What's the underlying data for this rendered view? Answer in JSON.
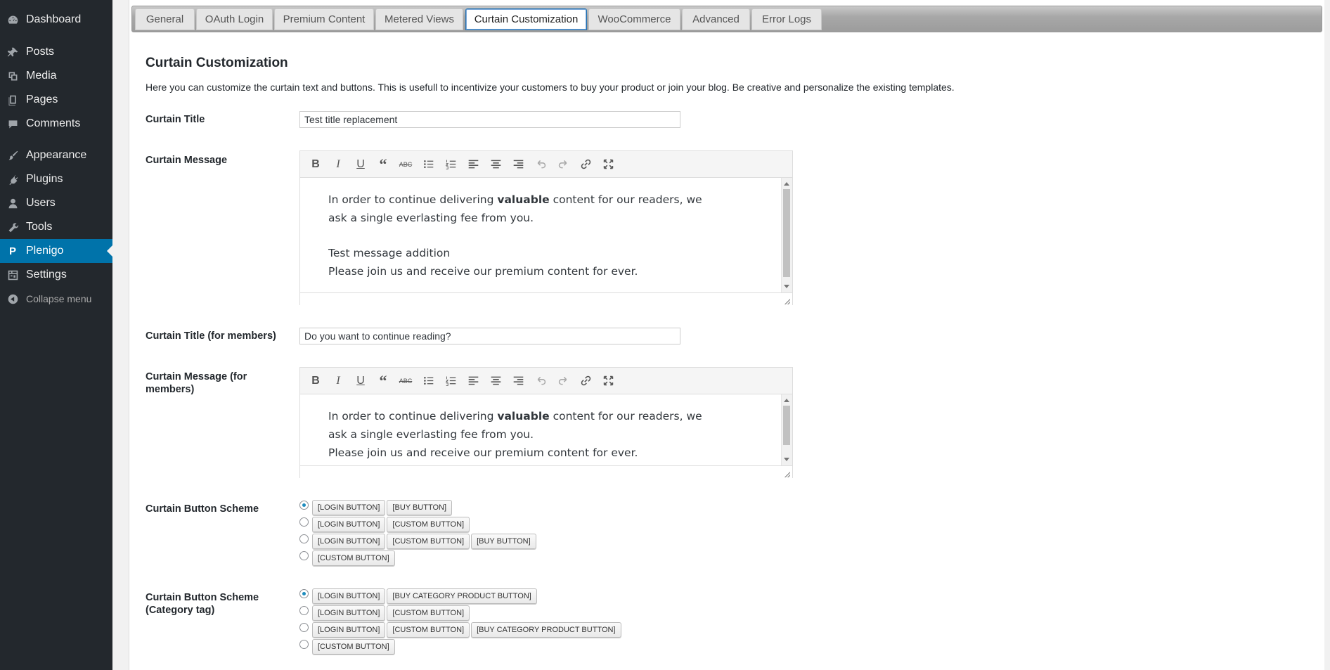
{
  "sidebar": {
    "items": [
      {
        "label": "Dashboard",
        "icon": "dashboard-icon"
      },
      {
        "label": "Posts",
        "icon": "pin-icon"
      },
      {
        "label": "Media",
        "icon": "media-icon"
      },
      {
        "label": "Pages",
        "icon": "pages-icon"
      },
      {
        "label": "Comments",
        "icon": "comments-icon"
      },
      {
        "label": "Appearance",
        "icon": "paintbrush-icon"
      },
      {
        "label": "Plugins",
        "icon": "plugin-icon"
      },
      {
        "label": "Users",
        "icon": "users-icon"
      },
      {
        "label": "Tools",
        "icon": "wrench-icon"
      },
      {
        "label": "Plenigo",
        "icon": "P"
      },
      {
        "label": "Settings",
        "icon": "settings-icon"
      },
      {
        "label": "Collapse menu",
        "icon": "collapse-icon"
      }
    ],
    "active": "Plenigo"
  },
  "tabs": [
    "General",
    "OAuth Login",
    "Premium Content",
    "Metered Views",
    "Curtain Customization",
    "WooCommerce",
    "Advanced",
    "Error Logs"
  ],
  "active_tab": "Curtain Customization",
  "section": {
    "title": "Curtain Customization",
    "intro": "Here you can customize the curtain text and buttons. This is usefull to incentivize your customers to buy your product or join your blog. Be creative and personalize the existing templates."
  },
  "fields": {
    "curtain_title": {
      "label": "Curtain Title",
      "value": "Test title replacement"
    },
    "curtain_message": {
      "label": "Curtain Message",
      "text_before": "In order to continue delivering ",
      "text_bold": "valuable",
      "text_after": " content for our readers, we ask a single everlasting fee from you.",
      "line3": "Test message addition",
      "line4": "Please join us and receive our premium content for ever."
    },
    "curtain_title_members": {
      "label": "Curtain Title (for members)",
      "value": "Do you want to continue reading?"
    },
    "curtain_message_members": {
      "label": "Curtain Message (for members)",
      "text_before": "In order to continue delivering ",
      "text_bold": "valuable",
      "text_after": " content for our readers, we ask a single everlasting fee from you.",
      "line3": "Please join us and receive our premium content for ever."
    },
    "button_scheme": {
      "label": "Curtain Button Scheme",
      "selected": 0,
      "options": [
        [
          "[LOGIN BUTTON]",
          "[BUY BUTTON]"
        ],
        [
          "[LOGIN BUTTON]",
          "[CUSTOM BUTTON]"
        ],
        [
          "[LOGIN BUTTON]",
          "[CUSTOM BUTTON]",
          "[BUY BUTTON]"
        ],
        [
          "[CUSTOM BUTTON]"
        ]
      ]
    },
    "button_scheme_category": {
      "label": "Curtain Button Scheme (Category tag)",
      "selected": 0,
      "options": [
        [
          "[LOGIN BUTTON]",
          "[BUY CATEGORY PRODUCT BUTTON]"
        ],
        [
          "[LOGIN BUTTON]",
          "[CUSTOM BUTTON]"
        ],
        [
          "[LOGIN BUTTON]",
          "[CUSTOM BUTTON]",
          "[BUY CATEGORY PRODUCT BUTTON]"
        ],
        [
          "[CUSTOM BUTTON]"
        ]
      ]
    }
  },
  "colors": {
    "sidebar_bg": "#23282d",
    "active_menu": "#0073aa",
    "active_tab_border": "#2271b1"
  }
}
